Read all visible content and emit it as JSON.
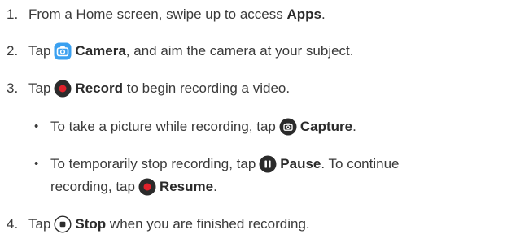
{
  "steps": [
    {
      "num": "1.",
      "pre": "From a Home screen, swipe up to access ",
      "bold": "Apps",
      "post": "."
    },
    {
      "num": "2.",
      "pre": "Tap",
      "icon": "camera-app-icon",
      "bold": "Camera",
      "post": ", and aim the camera at your subject."
    },
    {
      "num": "3.",
      "pre": "Tap",
      "icon": "record-icon",
      "bold": "Record",
      "post": " to begin recording a video."
    },
    {
      "num": "4.",
      "pre": "Tap",
      "icon": "stop-icon",
      "bold": "Stop",
      "post": " when you are finished recording."
    }
  ],
  "bullets": [
    {
      "marker": "•",
      "pre": "To take a picture while recording, tap",
      "icon": "capture-icon",
      "bold": "Capture",
      "post": "."
    },
    {
      "marker": "•",
      "pre": "To temporarily stop recording, tap",
      "icon": "pause-icon",
      "bold": "Pause",
      "post": ". To continue",
      "line2_pre": "recording, tap",
      "line2_icon": "resume-icon",
      "line2_bold": "Resume",
      "line2_post": "."
    }
  ],
  "colors": {
    "record_red": "#e0212b",
    "icon_dark": "#2b2b2b",
    "camera_blue": "#3aa0f0"
  }
}
